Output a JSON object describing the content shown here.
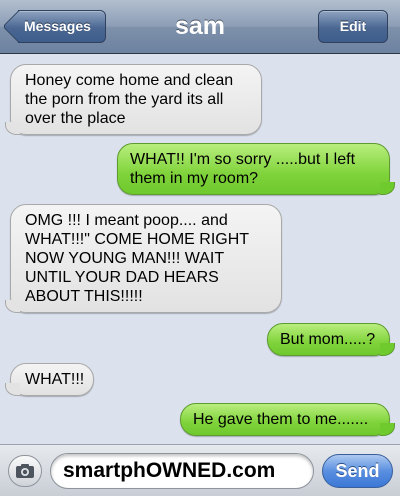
{
  "header": {
    "back_label": "Messages",
    "title": "sam",
    "edit_label": "Edit"
  },
  "messages": [
    {
      "from": "them",
      "text": "Honey come home and clean the porn from the yard its all over the place"
    },
    {
      "from": "me",
      "text": "WHAT!! I'm so sorry .....but I left them in my room?"
    },
    {
      "from": "them",
      "text": "OMG !!! I meant poop.... and WHAT!!!\" COME HOME RIGHT NOW YOUNG MAN!!! WAIT UNTIL YOUR DAD HEARS ABOUT THIS!!!!!"
    },
    {
      "from": "me",
      "text": "But mom.....?"
    },
    {
      "from": "them",
      "text": "WHAT!!!"
    },
    {
      "from": "me",
      "text": "He gave them to me......."
    }
  ],
  "composer": {
    "camera_icon": "camera-icon",
    "text": "smartphOWNED.com",
    "send_label": "Send"
  },
  "colors": {
    "sent_bubble": "#7fd33a",
    "received_bubble": "#e6e6e6",
    "nav_bar": "#7e91ab",
    "send_button": "#3b78d6"
  }
}
